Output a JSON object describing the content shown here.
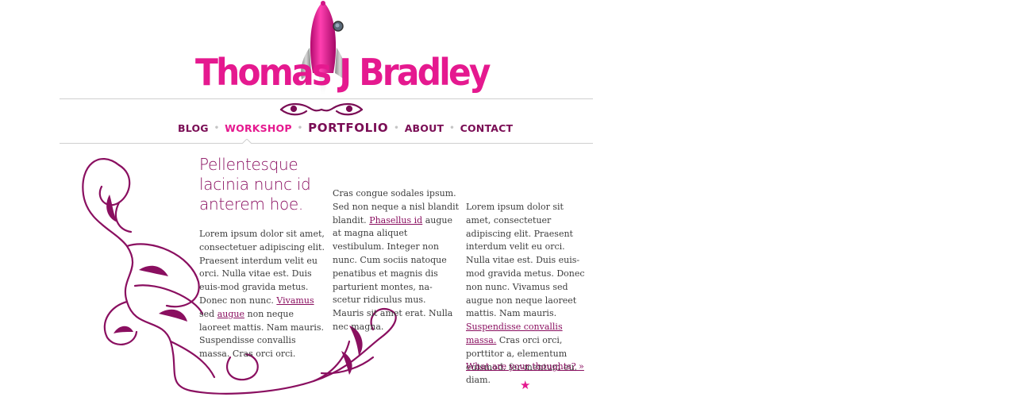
{
  "site": {
    "title": "Thomas J Bradley"
  },
  "nav": {
    "items": [
      {
        "label": "BLOG"
      },
      {
        "label": "WORKSHOP"
      },
      {
        "label": "PORTFOLIO"
      },
      {
        "label": "ABOUT"
      },
      {
        "label": "CONTACT"
      }
    ],
    "separator": "•"
  },
  "content": {
    "headline": "Pellentesque lacinia nunc id anterem hoe.",
    "col1": {
      "p1": "Lorem ipsum dolor sit amet, consectetuer adipiscing elit. Praesent interdum velit eu orci. Nulla vitae est. Duis euis-mod gravida metus. Donec non nunc. ",
      "link1": "Vivamus",
      "mid": " sed ",
      "link2": "augue",
      "p2": " non neque laoreet mattis. Nam mauris. Suspendisse convallis massa. Cras orci orci."
    },
    "col2": {
      "p1": "Cras congue sodales ipsum. Sed non neque a nisl blandit blandit. ",
      "link1": "Phasellus id",
      "p2": " augue at magna aliquet vestibulum. Integer non nunc. Cum sociis natoque penatibus et magnis dis parturient montes, na-scetur ridiculus mus. Mauris sit amet erat. Nulla nec magna."
    },
    "col3": {
      "p1": "Lorem ipsum dolor sit amet, consectetuer adipiscing elit. Praesent interdum velit eu orci. Nulla vitae est. Duis euis-mod gravida metus. Donec non nunc. Vivamus sed augue non neque laoreet mattis. Nam mauris. ",
      "link1": "Suspendisse convallis massa.",
      "p2": " Cras orci orci, porttitor a, elementum euismod, fer-mentum eu, diam."
    },
    "cta": "What are your thoughts? »",
    "star": "★"
  },
  "colors": {
    "brand_pink": "#e5198f",
    "plum": "#8a0f60",
    "rule": "#cfcfcf"
  }
}
